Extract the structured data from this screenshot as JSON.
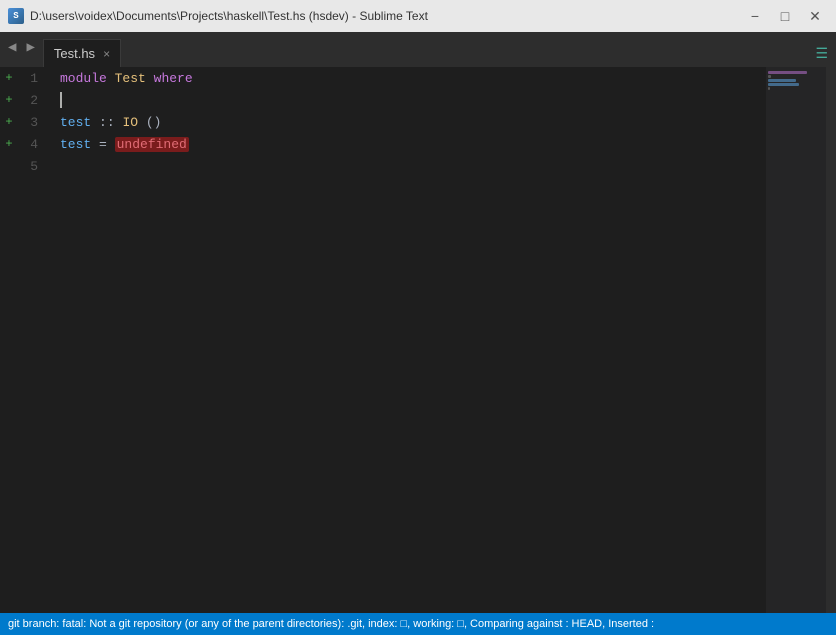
{
  "titlebar": {
    "icon_label": "S",
    "title": "D:\\users\\voidex\\Documents\\Projects\\haskell\\Test.hs (hsdev) - Sublime Text",
    "minimize_label": "−",
    "maximize_label": "□",
    "close_label": "✕"
  },
  "tabs": {
    "active_tab": {
      "label": "Test.hs",
      "close_label": "×"
    }
  },
  "editor": {
    "lines": [
      {
        "num": "1",
        "has_plus": true,
        "segments": [
          {
            "type": "kw-module",
            "text": "module"
          },
          {
            "type": "plain",
            "text": " "
          },
          {
            "type": "kw-name",
            "text": "Test"
          },
          {
            "type": "plain",
            "text": " "
          },
          {
            "type": "kw-where",
            "text": "where"
          }
        ]
      },
      {
        "num": "2",
        "has_plus": true,
        "cursor": true,
        "segments": []
      },
      {
        "num": "3",
        "has_plus": true,
        "segments": [
          {
            "type": "fn-name",
            "text": "test"
          },
          {
            "type": "plain",
            "text": " :: "
          },
          {
            "type": "type-name",
            "text": "IO"
          },
          {
            "type": "plain",
            "text": " ()"
          }
        ]
      },
      {
        "num": "4",
        "has_plus": true,
        "segments": [
          {
            "type": "fn-def",
            "text": "test"
          },
          {
            "type": "plain",
            "text": " = "
          },
          {
            "type": "kw-undefined",
            "text": "undefined"
          }
        ]
      },
      {
        "num": "5",
        "has_plus": false,
        "segments": []
      }
    ]
  },
  "status": {
    "text": "git branch: fatal: Not a git repository (or any of the parent directories): .git, index: □, working: □, Comparing against : HEAD, Inserted : "
  }
}
